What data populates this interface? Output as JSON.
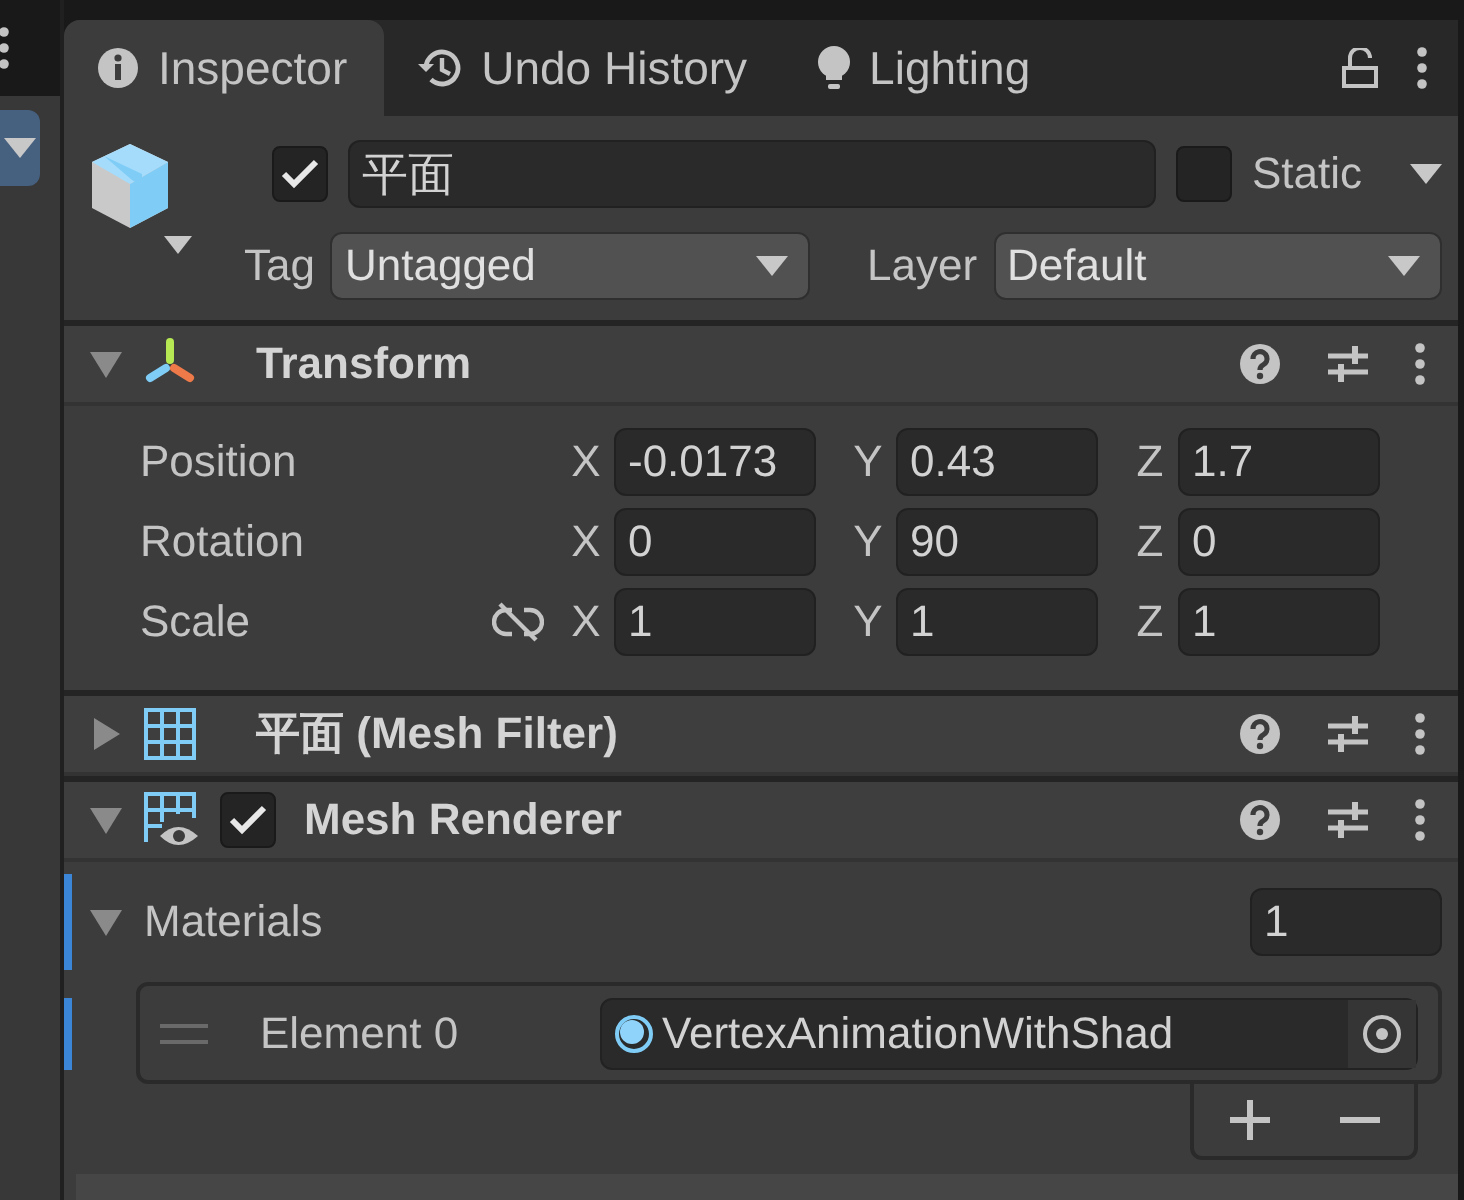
{
  "tabs": [
    {
      "label": "Inspector",
      "kind": "info",
      "selected": true
    },
    {
      "label": "Undo History",
      "kind": "history",
      "selected": false
    },
    {
      "label": "Lighting",
      "kind": "bulb",
      "selected": false
    }
  ],
  "game_object": {
    "active": true,
    "name": "平面",
    "static": false,
    "static_label": "Static",
    "tag_label": "Tag",
    "tag": "Untagged",
    "layer_label": "Layer",
    "layer": "Default"
  },
  "components": [
    {
      "kind": "transform",
      "title": "Transform",
      "expanded": true,
      "rows": [
        {
          "label": "Position",
          "values": [
            {
              "axis": "X",
              "value": "-0.0173"
            },
            {
              "axis": "Y",
              "value": "0.43"
            },
            {
              "axis": "Z",
              "value": "1.7"
            }
          ]
        },
        {
          "label": "Rotation",
          "values": [
            {
              "axis": "X",
              "value": "0"
            },
            {
              "axis": "Y",
              "value": "90"
            },
            {
              "axis": "Z",
              "value": "0"
            }
          ]
        },
        {
          "label": "Scale",
          "constrained": false,
          "values": [
            {
              "axis": "X",
              "value": "1"
            },
            {
              "axis": "Y",
              "value": "1"
            },
            {
              "axis": "Z",
              "value": "1"
            }
          ]
        }
      ]
    },
    {
      "kind": "mesh_filter",
      "title": "平面 (Mesh Filter)",
      "expanded": false
    },
    {
      "kind": "mesh_renderer",
      "title": "Mesh Renderer",
      "expanded": true,
      "enabled": true,
      "materials": {
        "label": "Materials",
        "expanded": true,
        "count": "1",
        "elements": [
          {
            "label": "Element 0",
            "value": "VertexAnimationWithShad"
          }
        ]
      }
    }
  ]
}
